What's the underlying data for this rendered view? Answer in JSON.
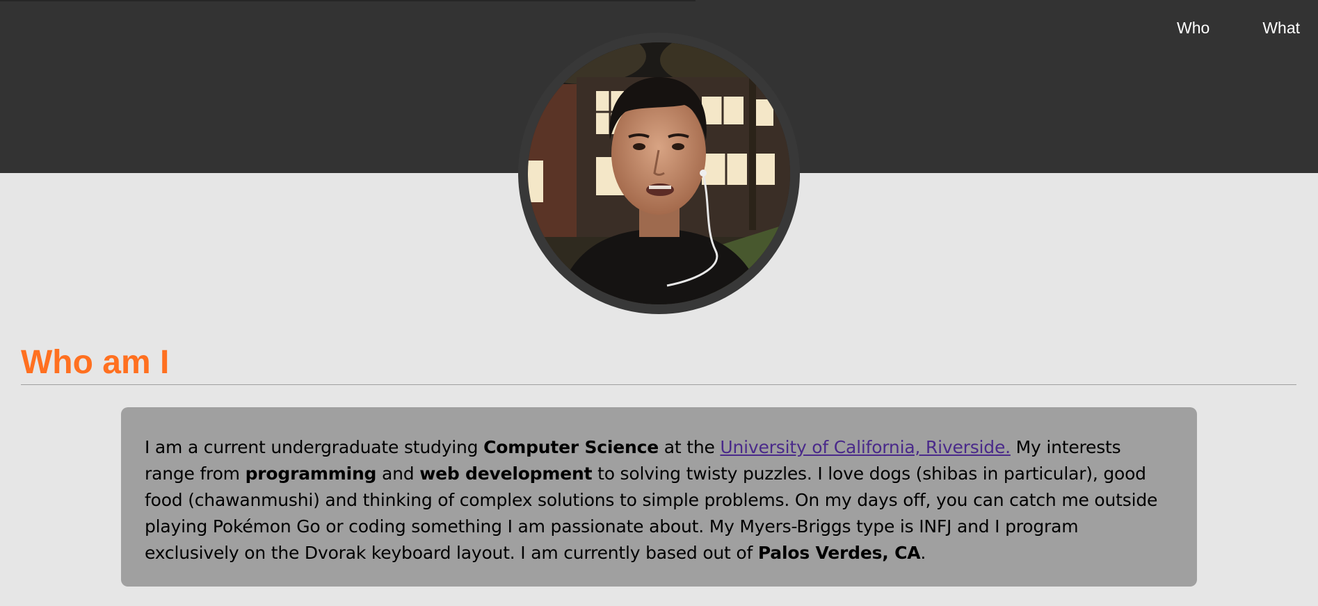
{
  "nav": {
    "items": [
      {
        "label": "Who"
      },
      {
        "label": "What"
      }
    ]
  },
  "profile": {
    "photo_icon": "portrait-photo"
  },
  "section": {
    "title": "Who am I"
  },
  "bio": {
    "s1": "I am a current undergraduate studying ",
    "b1": "Computer Science",
    "s2": " at the ",
    "link": "University of California, Riverside.",
    "s3": " My interests range from ",
    "b2": "programming",
    "s4": " and ",
    "b3": "web development",
    "s5": " to solving twisty puzzles. I love dogs (shibas in particular), good food (chawanmushi) and thinking of complex solutions to simple problems. On my days off, you can catch me outside playing Pokémon Go or coding something I am passionate about. My Myers-Briggs type is INFJ and I program exclusively on the Dvorak keyboard layout. I am currently based out of ",
    "b4": "Palos Verdes, CA",
    "s6": "."
  },
  "colors": {
    "header_bg": "#333333",
    "page_bg": "#e6e6e6",
    "title": "#ff7020",
    "card_bg": "#a0a0a0",
    "link": "#4a2a8a"
  }
}
